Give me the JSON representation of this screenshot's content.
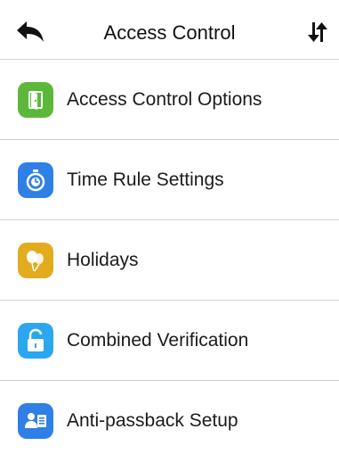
{
  "header": {
    "title": "Access Control",
    "back_icon": "back-arrow-icon",
    "sort_icon": "sort-arrows-icon"
  },
  "menu": {
    "items": [
      {
        "label": "Access Control Options",
        "icon": "door-icon",
        "color": "#5cb83a"
      },
      {
        "label": "Time Rule Settings",
        "icon": "stopwatch-icon",
        "color": "#2f7fe6"
      },
      {
        "label": "Holidays",
        "icon": "balloons-icon",
        "color": "#e3ac1e"
      },
      {
        "label": "Combined Verification",
        "icon": "unlock-icon",
        "color": "#2aa7ee"
      },
      {
        "label": "Anti-passback Setup",
        "icon": "users-icon",
        "color": "#2f7fe6"
      }
    ]
  }
}
